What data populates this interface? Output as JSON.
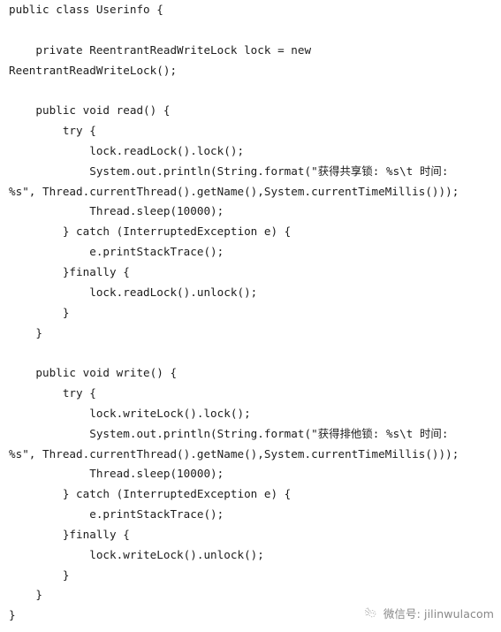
{
  "document": {
    "type": "java-source-code",
    "language": "Java",
    "class_name": "Userinfo",
    "background_color": "#ffffff",
    "text_color": "#1c1c1c"
  },
  "code": {
    "lines": [
      "public class Userinfo {",
      "",
      "    private ReentrantReadWriteLock lock = new",
      "ReentrantReadWriteLock();",
      "",
      "    public void read() {",
      "        try {",
      "            lock.readLock().lock();",
      "            System.out.println(String.format(\"获得共享锁: %s\\t 时间:",
      "%s\", Thread.currentThread().getName(),System.currentTimeMillis()));",
      "            Thread.sleep(10000);",
      "        } catch (InterruptedException e) {",
      "            e.printStackTrace();",
      "        }finally {",
      "            lock.readLock().unlock();",
      "        }",
      "    }",
      "",
      "    public void write() {",
      "        try {",
      "            lock.writeLock().lock();",
      "            System.out.println(String.format(\"获得排他锁: %s\\t 时间:",
      "%s\", Thread.currentThread().getName(),System.currentTimeMillis()));",
      "            Thread.sleep(10000);",
      "        } catch (InterruptedException e) {",
      "            e.printStackTrace();",
      "        }finally {",
      "            lock.writeLock().unlock();",
      "        }",
      "    }",
      "}"
    ]
  },
  "watermark": {
    "icon": "wechat-sparkle-logo-icon",
    "label": "微信号: jilinwulacom",
    "color": "#5a5a5a"
  }
}
